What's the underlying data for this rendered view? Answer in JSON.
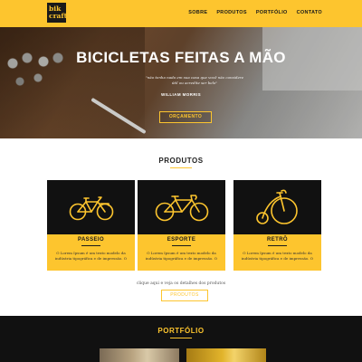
{
  "header": {
    "logo_line1": "bik",
    "logo_line2": "craft",
    "nav": [
      "SOBRE",
      "PRODUTOS",
      "PORTFÓLIO",
      "CONTATO"
    ]
  },
  "hero": {
    "title": "BICICLETAS FEITAS A MÃO",
    "quote": "\"não tenha nada em sua casa que você não considere útil ou acredite ser belo\"",
    "author": "WILLIAM MORRIS",
    "button": "ORÇAMENTO"
  },
  "products": {
    "title": "PRODUTOS",
    "cards": [
      {
        "label": "PASSEIO",
        "text": "O Lorem Ipsum é um texto modelo da indústria tipográfica e de impressão. O",
        "icon": "city-bike-icon"
      },
      {
        "label": "ESPORTE",
        "text": "O Lorem Ipsum é um texto modelo da indústria tipográfica e de impressão. O",
        "icon": "road-bike-icon"
      },
      {
        "label": "RETRÔ",
        "text": "O Lorem Ipsum é um texto modelo da indústria tipográfica e de impressão. O",
        "icon": "penny-farthing-icon"
      }
    ],
    "detail_text": "clique aqui e veja os detalhes dos produtos",
    "button": "PRODUTOS"
  },
  "portfolio": {
    "title": "PORTFÓLIO"
  },
  "colors": {
    "accent": "#fdc52e",
    "dark": "#111111"
  }
}
